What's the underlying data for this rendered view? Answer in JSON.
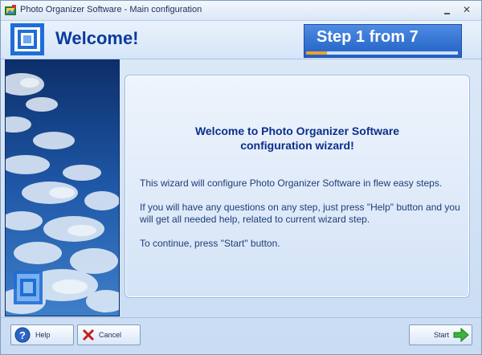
{
  "window": {
    "title": "Photo Organizer Software - Main configuration"
  },
  "header": {
    "heading": "Welcome!",
    "step_text": "Step 1 from 7",
    "step_progress": 0.14
  },
  "panel": {
    "title_line1": "Welcome to Photo Organizer Software",
    "title_line2": "configuration wizard!",
    "paragraph1": "This wizard will configure Photo Organizer Software in flew easy steps.",
    "paragraph2": "If you will have any questions on any step, just press \"Help\" button and you will get all needed help, related to current wizard step.",
    "paragraph3": "To continue, press \"Start\" button."
  },
  "footer": {
    "help_label": "Help",
    "cancel_label": "Cancel",
    "start_label": "Start"
  },
  "colors": {
    "accent": "#0b3a9e",
    "banner": "#2f6fd3",
    "progress": "#f0a030"
  },
  "icons": {
    "app": "photo-organizer-app-icon",
    "logo": "nested-squares-logo",
    "help": "question-mark-icon",
    "cancel": "red-x-icon",
    "start": "green-arrow-right-icon"
  }
}
